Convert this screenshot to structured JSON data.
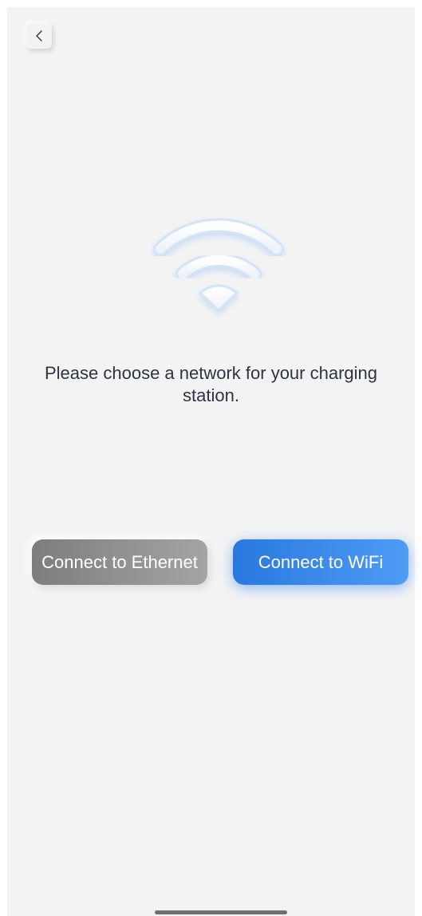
{
  "header": {
    "back_icon": "chevron-left-icon"
  },
  "hero": {
    "icon": "wifi-icon",
    "accent_color": "#4a90e2"
  },
  "main": {
    "prompt": "Please choose a network for your charging station."
  },
  "actions": {
    "ethernet_label": "Connect to Ethernet",
    "wifi_label": "Connect to WiFi",
    "ethernet_color": "#8e8e8e",
    "wifi_color": "#3a8af0"
  }
}
